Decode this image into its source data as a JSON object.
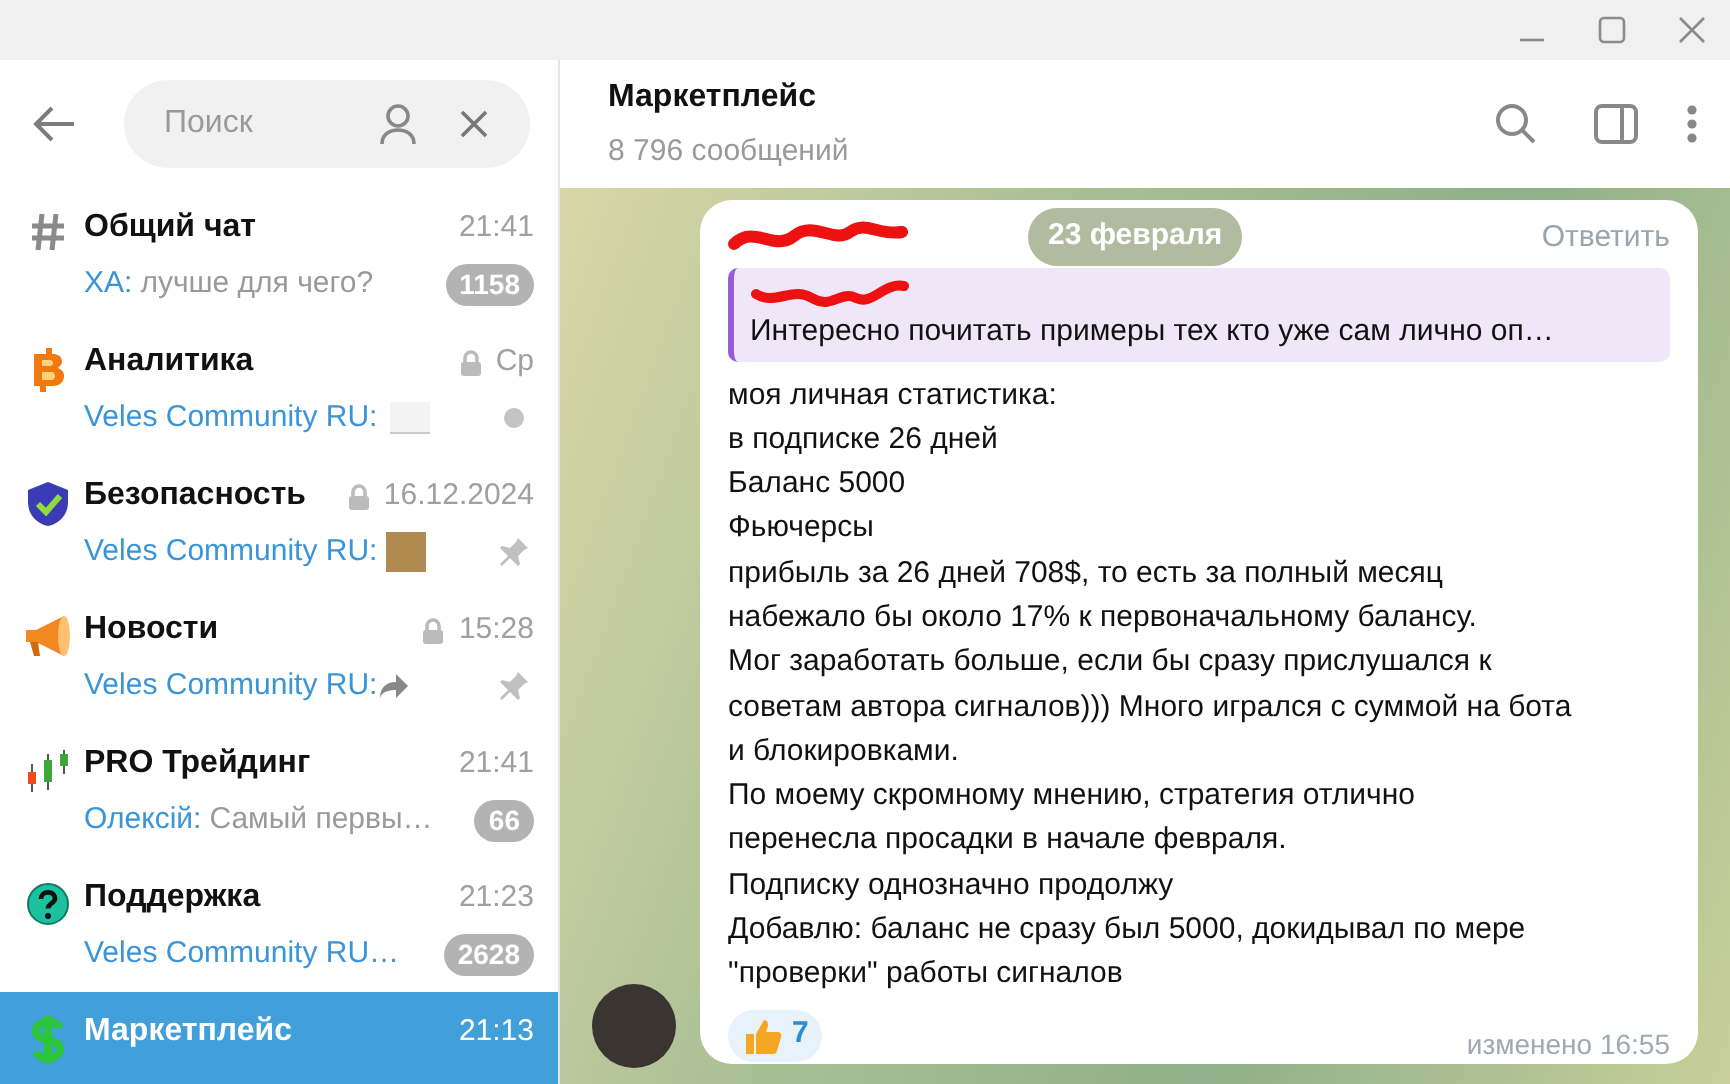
{
  "search": {
    "placeholder": "Поиск"
  },
  "chats": [
    {
      "kind": "hash",
      "title": "Общий чат",
      "time": "21:41",
      "locked": false,
      "sender": "ХА:",
      "text": "лучше для чего?",
      "unread": "1158",
      "pinned": false,
      "marked": false,
      "selected": false
    },
    {
      "kind": "bitcoin",
      "title": "Аналитика",
      "time": "Ср",
      "locked": true,
      "sender": "Veles Community RU:",
      "attachment": {
        "kind": "chart"
      },
      "pinned": false,
      "marked": true,
      "selected": false
    },
    {
      "kind": "shield",
      "title": "Безопасность",
      "time": "16.12.2024",
      "locked": true,
      "sender": "Veles Community RU:",
      "attachment": {
        "kind": "photo"
      },
      "pinned": true,
      "marked": false,
      "selected": false
    },
    {
      "kind": "megaphone",
      "title": "Новости",
      "time": "15:28",
      "locked": true,
      "sender": "Veles Community RU:",
      "attachment": {
        "kind": "forward"
      },
      "pinned": true,
      "marked": false,
      "selected": false
    },
    {
      "kind": "candles",
      "title": "PRO Трейдинг",
      "time": "21:41",
      "locked": false,
      "sender": "Олексій:",
      "text": "Самый первы…",
      "unread": "66",
      "pinned": false,
      "marked": false,
      "selected": false
    },
    {
      "kind": "question",
      "title": "Поддержка",
      "time": "21:23",
      "locked": false,
      "sender": "Veles Community RU…",
      "unread": "2628",
      "pinned": false,
      "marked": false,
      "selected": false
    },
    {
      "kind": "dollar",
      "title": "Маркетплейс",
      "time": "21:13",
      "locked": false,
      "pinned": false,
      "marked": false,
      "selected": true
    }
  ],
  "header": {
    "title": "Маркетплейс",
    "subtitle": "8 796 сообщений"
  },
  "date_pill": "23 февраля",
  "message": {
    "reply_label": "Ответить",
    "quote": "Интересно почитать примеры тех кто уже сам лично оп…",
    "lines": [
      "моя личная статистика:",
      "в подписке 26 дней",
      "Баланс 5000",
      "Фьючерсы",
      "прибыль за 26 дней 708$, то есть за полный месяц",
      "набежало бы около 17% к первоначальному балансу.",
      "Мог заработать больше, если бы сразу прислушался к",
      "советам автора сигналов))) Много игрался с суммой на бота",
      "и блокировками.",
      "По моему скромному мнению, стратегия отлично",
      "перенесла просадки в начале февраля.",
      "Подписку однозначно продолжу",
      "Добавлю: баланс не сразу был 5000, докидывал по мере",
      "\"проверки\" работы сигналов"
    ],
    "reaction_count": "7",
    "edited": "изменено 16:55"
  }
}
